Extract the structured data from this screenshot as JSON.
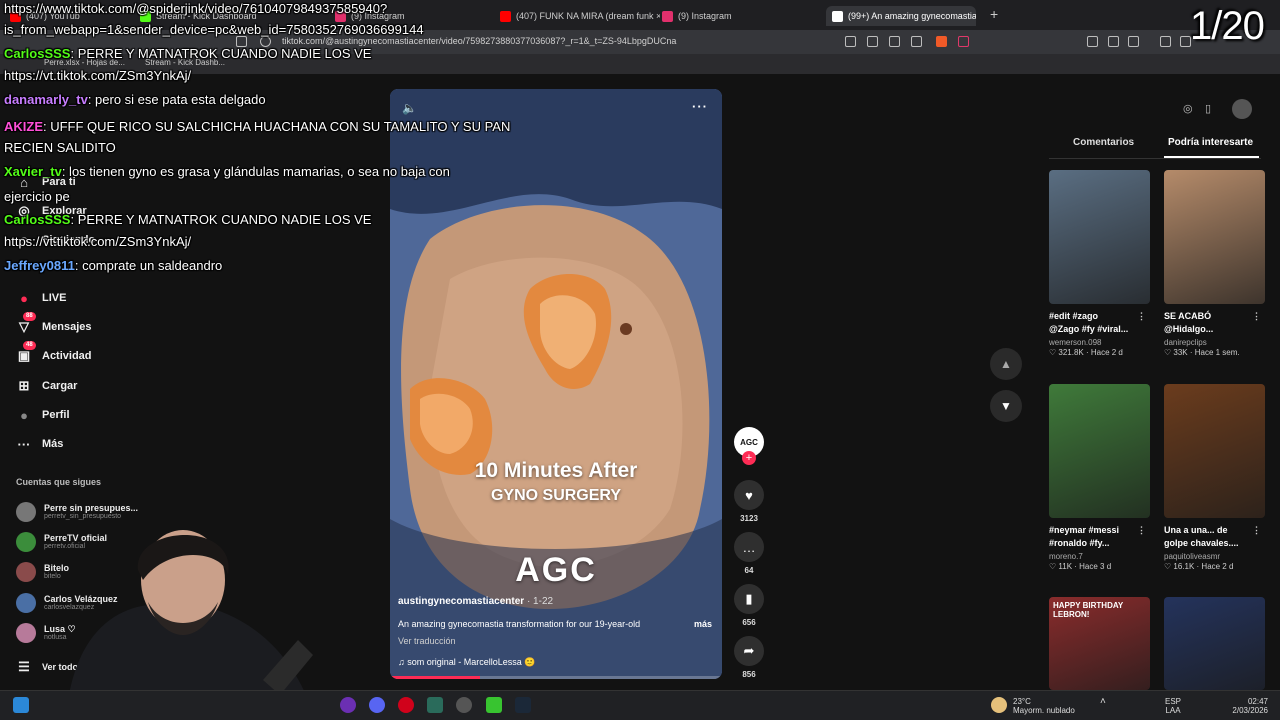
{
  "browser": {
    "tabs": [
      {
        "label": "(407) YouTube",
        "color": "#ff0000"
      },
      {
        "label": "Stream - Kick Dashboard",
        "color": "#53fc18"
      },
      {
        "label": "(9) Instagram",
        "color": "#e1306c"
      },
      {
        "label": "(407) FUNK NA MIRA (dream funk ×",
        "color": "#ff0000"
      },
      {
        "label": "(9) Instagram",
        "color": "#e1306c"
      },
      {
        "label": "(99+) An amazing gynecomastia",
        "color": "#ffffff",
        "active": true
      }
    ],
    "url": "tiktok.com/@austingynecomastiacenter/video/7598273880377036087?_r=1&_t=ZS-94LbpgDUCna",
    "bookmarks": [
      "Perre.xlsx - Hojas de...",
      "Stream - Kick Dashb..."
    ]
  },
  "sidebar": {
    "items": [
      {
        "label": "Para ti",
        "icon": "home-icon"
      },
      {
        "label": "Explorar",
        "icon": "compass-icon"
      },
      {
        "label": "Siguiendo",
        "icon": "following-icon"
      },
      {
        "label": "LIVE",
        "icon": "live-icon"
      },
      {
        "label": "Mensajes",
        "icon": "message-icon",
        "badge": "88"
      },
      {
        "label": "Actividad",
        "icon": "bell-icon",
        "badge": "48"
      },
      {
        "label": "Cargar",
        "icon": "upload-icon"
      },
      {
        "label": "Perfil",
        "icon": "profile-icon"
      },
      {
        "label": "Más",
        "icon": "more-icon"
      }
    ],
    "following_title": "Cuentas que sigues",
    "following": [
      {
        "name": "Perre sin presupues...",
        "handle": "perretv_sin_presupuesto",
        "color": "#777"
      },
      {
        "name": "PerreTV oficial",
        "handle": "perretv.oficial",
        "color": "#3b8d3b"
      },
      {
        "name": "Bitelo",
        "handle": "bitelo",
        "color": "#8a4b4b"
      },
      {
        "name": "Carlos Velázquez",
        "handle": "carlosvelazquez",
        "color": "#4a6fa5"
      },
      {
        "name": "Lusa ♡",
        "handle": "notlusa",
        "color": "#b77a9a"
      }
    ],
    "see_more": "Ver todo"
  },
  "video": {
    "overlay_line1": "10 Minutes After",
    "overlay_line2": "GYNO SURGERY",
    "logo_text": "AGC",
    "author": "austingynecomastiacenter",
    "date": " · 1-22",
    "description": "An amazing gynecomastia transformation for our 19-year-old",
    "more": "más",
    "translate": "Ver traducción",
    "sound": "♫  som original - MarcelloLessa 🙂",
    "progress": 0.27
  },
  "actions": {
    "avatar": "AGC",
    "likes": "3123",
    "comments": "64",
    "saves": "656",
    "shares": "856"
  },
  "right_panel": {
    "tabs": [
      "Comentarios",
      "Podría interesarte"
    ],
    "cards": [
      {
        "title": "#edit #zago\n@Zago #fy #viral...",
        "author": "wemerson.098",
        "meta": "♡ 321.8K · Hace 2 d",
        "bg": "#5a6e82"
      },
      {
        "title": "SE ACABÓ\n@Hidalgo...",
        "author": "danirepclips",
        "meta": "♡ 33K · Hace 1 sem.",
        "bg": "#b58b6a"
      },
      {
        "title": "#neymar #messi\n#ronaldo #fy...",
        "author": "moreno.7",
        "meta": "♡ 11K · Hace 3 d",
        "bg": "#3f7a3a"
      },
      {
        "title": "Una a una... de\ngolpe chavales....",
        "author": "paquitoliveasmr",
        "meta": "♡ 16.1K · Hace 2 d",
        "bg": "#6b3c1d"
      },
      {
        "title": "",
        "author": "",
        "meta": "",
        "bg": "#8a2c2c",
        "thumb_text": "HAPPY BIRTHDAY LEBRON!"
      },
      {
        "title": "",
        "author": "",
        "meta": "",
        "bg": "#24335c"
      }
    ]
  },
  "chat": [
    {
      "user": "",
      "text": "https://www.tiktok.com/@spiderjink/video/7610407984937585940?",
      "color": "#ffffff"
    },
    {
      "user": "",
      "text": "is_from_webapp=1&sender_device=pc&web_id=7580352769036699144",
      "color": "#ffffff"
    },
    {
      "user": "CarlosSSS",
      "text": ": PERRE Y MATNATROK CUANDO NADIE LOS VE",
      "color": "#53fc18"
    },
    {
      "user": "",
      "text": "https://vt.tiktok.com/ZSm3YnkAj/",
      "color": "#ffffff"
    },
    {
      "user": "danamarly_tv",
      "text": ": pero si ese pata esta delgado",
      "color": "#c77dff"
    },
    {
      "user": "AKIZE",
      "text": ": UFFF QUE RICO SU SALCHICHA HUACHANA CON SU TAMALITO Y SU PAN",
      "color": "#ff4fd8"
    },
    {
      "user": "",
      "text": "RECIEN SALIDITO",
      "color": "#ffffff"
    },
    {
      "user": "Xavier_tv",
      "text": ": los      tienen gyno es grasa y glándulas mamarias, o sea no baja con",
      "color": "#53fc18"
    },
    {
      "user": "",
      "text": "ejercicio pe",
      "color": "#ffffff"
    },
    {
      "user": "CarlosSSS",
      "text": ": PERRE Y MATNATROK CUANDO NADIE LOS VE",
      "color": "#53fc18"
    },
    {
      "user": "",
      "text": "https://vt.tiktok.com/ZSm3YnkAj/",
      "color": "#ffffff"
    },
    {
      "user": "Jeffrey0811",
      "text": ": comprate un saldeandro",
      "color": "#6aa8ff"
    }
  ],
  "counter": "1/20",
  "taskbar": {
    "weather_temp": "23°C",
    "weather_text": "Mayorm. nublado",
    "lang": "ESP",
    "lang2": "LAA",
    "time": "02:47",
    "date": "2/03/2026"
  }
}
